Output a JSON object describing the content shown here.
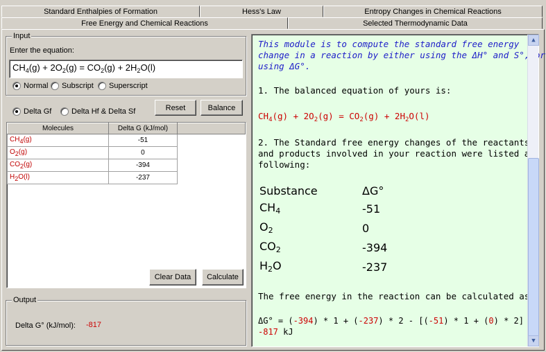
{
  "tabs": {
    "back": [
      "Standard Enthalpies of Formation",
      "Hess's Law",
      "Entropy Changes in Chemical Reactions"
    ],
    "front": [
      "Free Energy and Chemical Reactions",
      "Selected Thermodynamic Data"
    ],
    "active": "Free Energy and Chemical Reactions"
  },
  "input": {
    "group_title": "Input",
    "prompt": "Enter the equation:",
    "equation_parts": [
      "CH",
      "4",
      "(g) + 2O",
      "2",
      "(g) = CO",
      "2",
      "(g) + 2H",
      "2",
      "O(l)"
    ],
    "format_options": [
      "Normal",
      "Subscript",
      "Superscript"
    ],
    "format_selected": "Normal",
    "reset_label": "Reset",
    "balance_label": "Balance",
    "mode_options": [
      "Delta Gf",
      "Delta Hf & Delta Sf"
    ],
    "mode_selected": "Delta Gf"
  },
  "table": {
    "headers": [
      "Molecules",
      "Delta G (kJ/mol)"
    ],
    "rows": [
      {
        "mol": "CH",
        "sub": "4",
        "state": "(g)",
        "value": "-51"
      },
      {
        "mol": "O",
        "sub": "2",
        "state": "(g)",
        "value": "0"
      },
      {
        "mol": "CO",
        "sub": "2",
        "state": "(g)",
        "value": "-394"
      },
      {
        "mol": "H",
        "sub": "2",
        "state": "O(l)",
        "value": "-237"
      }
    ]
  },
  "buttons": {
    "clear_label": "Clear Data",
    "calculate_label": "Calculate"
  },
  "output": {
    "group_title": "Output",
    "label": "Delta G° (kJ/mol):",
    "value": "-817"
  },
  "explanation": {
    "intro": [
      "This module is to compute the standard free energy",
      "change in a reaction by either using the ΔH° and S°, or",
      "using ΔG°."
    ],
    "step1": "1. The balanced equation of yours is:",
    "step2": [
      "2. The Standard free energy changes of the reactants",
      "and products involved in your reaction were listed as",
      "following:"
    ],
    "col_substance": "Substance",
    "col_dg": "ΔG°",
    "substances": [
      {
        "name": "CH",
        "sub": "4",
        "value": "-51"
      },
      {
        "name": "O",
        "sub": "2",
        "value": "0"
      },
      {
        "name": "CO",
        "sub": "2",
        "value": "-394"
      },
      {
        "name": "H",
        "sub": "2",
        "tail": "O",
        "value": "-237"
      }
    ],
    "calc_intro": "The free energy in the reaction can be calculated as:",
    "formula_prefix": "ΔG° = (",
    "formula_result": "-817",
    "formula_unit": " kJ"
  }
}
